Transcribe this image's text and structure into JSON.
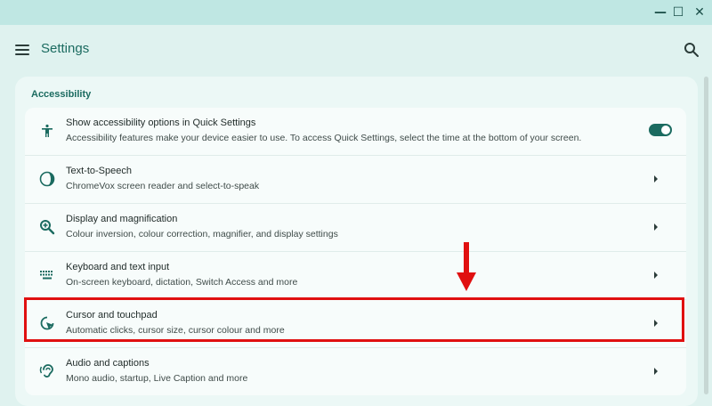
{
  "app": {
    "title": "Settings"
  },
  "window": {
    "minimize": "—",
    "maximize": "☐",
    "close": "✕"
  },
  "section": {
    "title": "Accessibility"
  },
  "items": [
    {
      "icon": "accessibility-icon",
      "title": "Show accessibility options in Quick Settings",
      "subtitle": "Accessibility features make your device easier to use. To access Quick Settings, select the time at the bottom of your screen.",
      "control": "toggle",
      "toggle_on": true
    },
    {
      "icon": "text-to-speech-icon",
      "title": "Text-to-Speech",
      "subtitle": "ChromeVox screen reader and select-to-speak",
      "control": "chevron"
    },
    {
      "icon": "magnifier-icon",
      "title": "Display and magnification",
      "subtitle": "Colour inversion, colour correction, magnifier, and display settings",
      "control": "chevron"
    },
    {
      "icon": "keyboard-icon",
      "title": "Keyboard and text input",
      "subtitle": "On-screen keyboard, dictation, Switch Access and more",
      "control": "chevron"
    },
    {
      "icon": "cursor-icon",
      "title": "Cursor and touchpad",
      "subtitle": "Automatic clicks, cursor size, cursor colour and more",
      "control": "chevron"
    },
    {
      "icon": "ear-icon",
      "title": "Audio and captions",
      "subtitle": "Mono audio, startup, Live Caption and more",
      "control": "chevron"
    }
  ],
  "colors": {
    "accent": "#1b6b60",
    "highlight": "#e01010",
    "background": "#dff2ef"
  }
}
